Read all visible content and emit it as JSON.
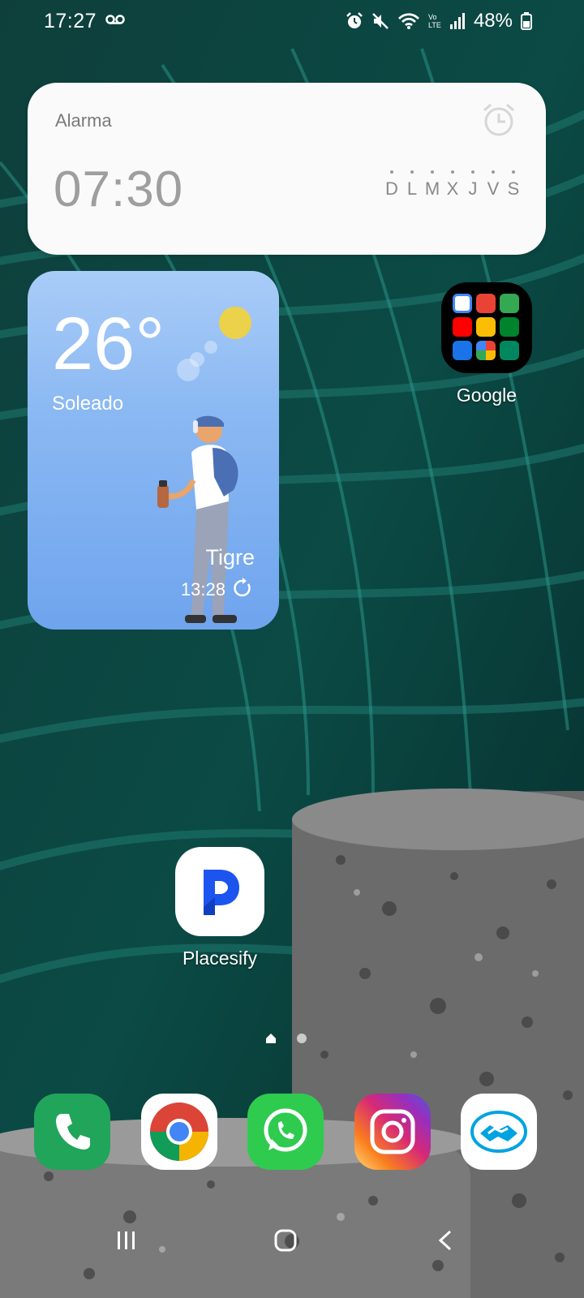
{
  "status_bar": {
    "time": "17:27",
    "battery": "48%",
    "icons": [
      "voicemail-icon",
      "alarm-icon",
      "mute-icon",
      "wifi-icon",
      "volte-icon",
      "signal-icon",
      "battery-icon"
    ]
  },
  "alarm_widget": {
    "label": "Alarma",
    "time": "07:30",
    "days": [
      "D",
      "L",
      "M",
      "X",
      "J",
      "V",
      "S"
    ]
  },
  "weather_widget": {
    "temperature": "26°",
    "condition": "Soleado",
    "location": "Tigre",
    "updated": "13:28"
  },
  "apps": {
    "google_folder": {
      "label": "Google"
    },
    "placesify": {
      "label": "Placesify"
    }
  },
  "dock": [
    "phone",
    "chrome",
    "whatsapp",
    "instagram",
    "mercado-pago"
  ],
  "colors": {
    "weather_bg": "#8ab8f2",
    "alarm_bg": "#fafafa",
    "placesify_blue": "#1c54f0",
    "phone_green": "#21a55a",
    "whatsapp_green": "#2ecb4f"
  }
}
